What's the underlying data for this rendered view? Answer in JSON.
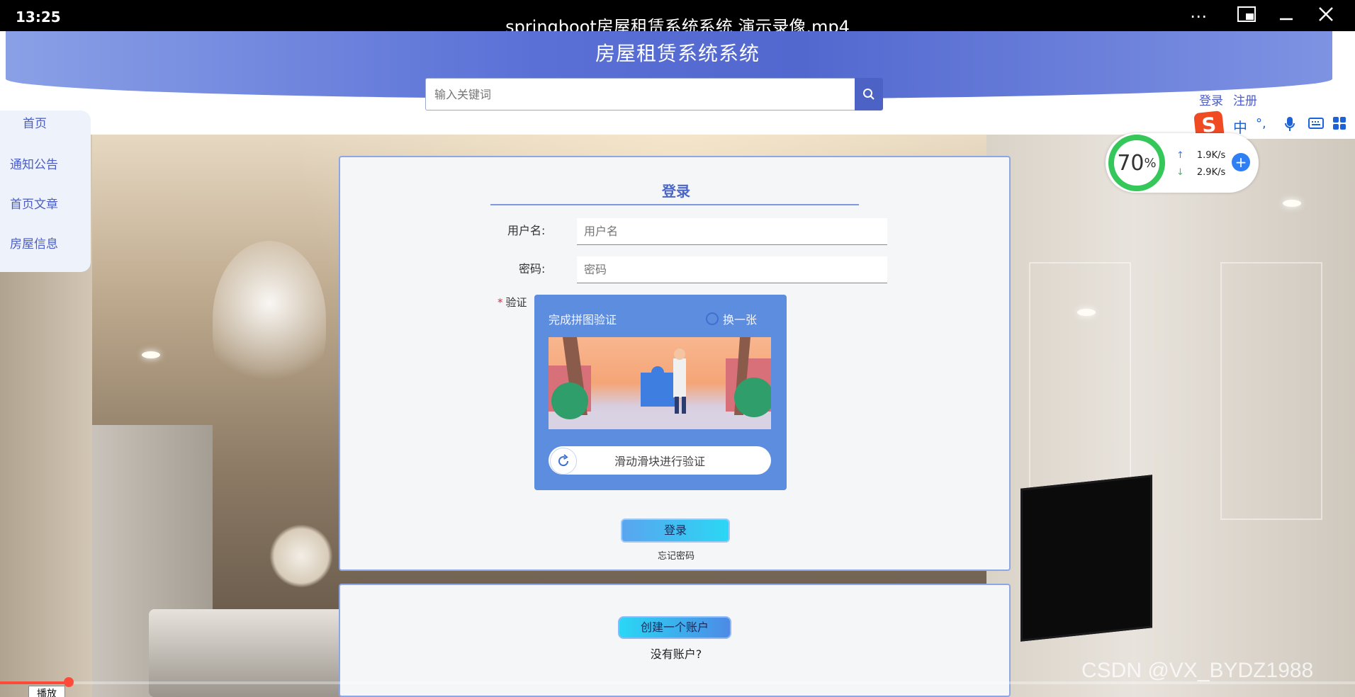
{
  "player": {
    "time": "13:25",
    "title": "springboot房屋租赁系统系统 演示录像.mp4",
    "more_icon": "more-icon",
    "pip_icon": "pip-icon",
    "minimize_icon": "minimize-icon",
    "close_icon": "close-icon",
    "play_tooltip": "播放",
    "progress_fraction": 0.05
  },
  "header": {
    "site_title": "房屋租赁系统系统",
    "search": {
      "placeholder": "输入关键词",
      "value": ""
    },
    "login_link": "登录",
    "register_link": "注册"
  },
  "sidebar": {
    "items": [
      {
        "label": "首页"
      },
      {
        "label": "通知公告"
      },
      {
        "label": "首页文章"
      },
      {
        "label": "房屋信息"
      }
    ]
  },
  "login": {
    "title": "登录",
    "username_label": "用户名:",
    "username_placeholder": "用户名",
    "password_label": "密码:",
    "password_placeholder": "密码",
    "captcha_required_mark": "*",
    "captcha_label": "验证",
    "captcha": {
      "prompt": "完成拼图验证",
      "refresh_label": "换一张",
      "slider_text": "滑动滑块进行验证"
    },
    "submit_label": "登录",
    "forgot_label": "忘记密码"
  },
  "register": {
    "create_label": "创建一个账户",
    "no_account_text": "没有账户?"
  },
  "ime": {
    "logo": "S",
    "mode": "中",
    "punct": "°,"
  },
  "network": {
    "percent": "70",
    "percent_unit": "%",
    "upload": "1.9K/s",
    "download": "2.9K/s"
  },
  "watermark": "CSDN @VX_BYDZ1988",
  "colors": {
    "brand": "#4c63c5",
    "accent_cyan": "#2ad7f4",
    "captcha_bg": "#5d8ddf",
    "ime_orange": "#f04a23",
    "ring_green": "#35c75a",
    "progress_red": "#ff4a3a"
  }
}
